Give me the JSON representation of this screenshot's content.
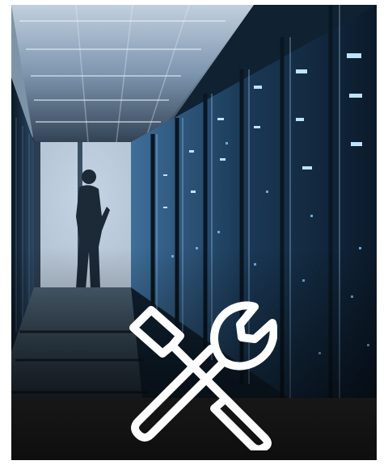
{
  "image": {
    "subject": "data-center-server-aisle",
    "icon": "tools-icon"
  },
  "colors": {
    "band": "#111111",
    "icon_stroke": "#ffffff",
    "server_blue": "#1e4f7d"
  }
}
